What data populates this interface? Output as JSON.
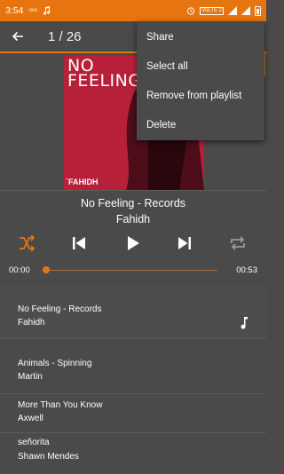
{
  "status_bar": {
    "time": "3:54",
    "carrier_small": "ovo",
    "volte": "VoLTE 2"
  },
  "toolbar": {
    "counter": "1 / 26"
  },
  "album_art": {
    "title": "NO FEELING",
    "artist": "`FAHIDH"
  },
  "now_playing": {
    "title": "No Feeling - Records",
    "artist": "Fahidh"
  },
  "seek": {
    "current": "00:00",
    "duration": "00:53",
    "progress": 0
  },
  "playlist": [
    {
      "title": "No Feeling - Records",
      "artist": "Fahidh",
      "playing": true
    },
    {
      "title": "Animals - Spinning",
      "artist": "Martin"
    },
    {
      "title": "More Than You Know",
      "artist": "Axwell"
    },
    {
      "title": "señorita",
      "artist": "Shawn Mendes"
    }
  ],
  "menu": {
    "items": [
      "Share",
      "Select all",
      "Remove from playlist",
      "Delete"
    ]
  },
  "colors": {
    "accent": "#e7750f",
    "background": "#4a4a4a",
    "album_bg": "#c0283a"
  },
  "icons": {
    "back": "arrow-left-icon",
    "shuffle": "shuffle-icon",
    "previous": "skip-previous-icon",
    "play": "play-icon",
    "next": "skip-next-icon",
    "repeat": "repeat-icon",
    "now_playing": "music-note-icon"
  }
}
